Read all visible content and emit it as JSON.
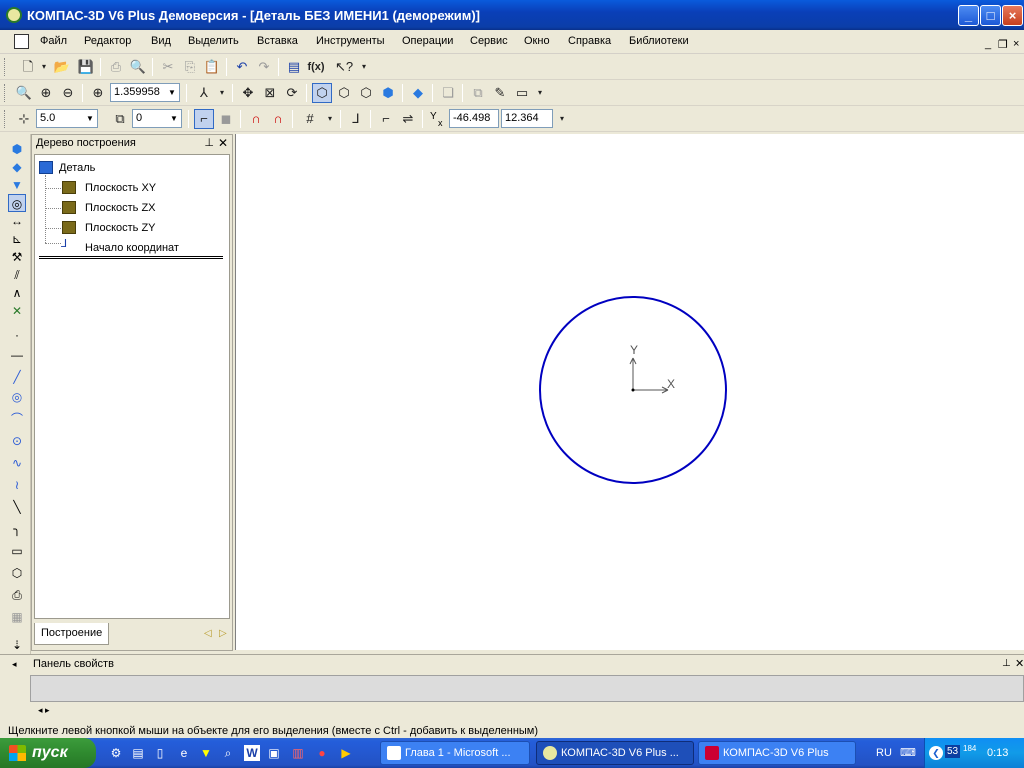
{
  "window": {
    "title": "КОМПАС-3D V6 Plus Демоверсия - [Деталь БЕЗ ИМЕНИ1 (деморежим)]",
    "controls": [
      "_",
      "□",
      "×"
    ]
  },
  "menu": {
    "items": [
      "Файл",
      "Редактор",
      "Вид",
      "Выделить",
      "Вставка",
      "Инструменты",
      "Операции",
      "Сервис",
      "Окно",
      "Справка",
      "Библиотеки"
    ],
    "mdi_controls": [
      "_",
      "❐",
      "×"
    ]
  },
  "toolbar_view": {
    "zoom_value": "1.359958"
  },
  "toolbar_sketch": {
    "step_value": "5.0",
    "layer_value": "0",
    "coord_x_label": "Y",
    "coord_x_sub": "x",
    "coord_x": "-46.498",
    "coord_y": "12.364"
  },
  "tree_panel": {
    "title": "Дерево построения",
    "root": "Деталь",
    "items": [
      "Плоскость XY",
      "Плоскость ZX",
      "Плоскость ZY",
      "Начало координат"
    ],
    "tab_label": "Построение"
  },
  "canvas": {
    "sketch_circle_color": "#0000c0",
    "axis_y_label": "Y",
    "axis_x_label": "X"
  },
  "properties_panel": {
    "title": "Панель свойств"
  },
  "status": {
    "hint": "Щелкните левой кнопкой мыши на объекте для его выделения (вместе с Ctrl - добавить к выделенным)"
  },
  "taskbar": {
    "start_label": "пуск",
    "tasks": [
      "Глава 1 - Microsoft ...",
      "КОМПАС-3D V6 Plus ...",
      "КОМПАС-3D V6 Plus"
    ],
    "language": "RU",
    "tray_numbers": [
      "53",
      "184"
    ],
    "clock": "0:13"
  },
  "colors": {
    "titlebar": "#0a3fb8",
    "taskbar": "#245edb",
    "start_button": "#2f8a2f",
    "sketch": "#0000c0"
  }
}
